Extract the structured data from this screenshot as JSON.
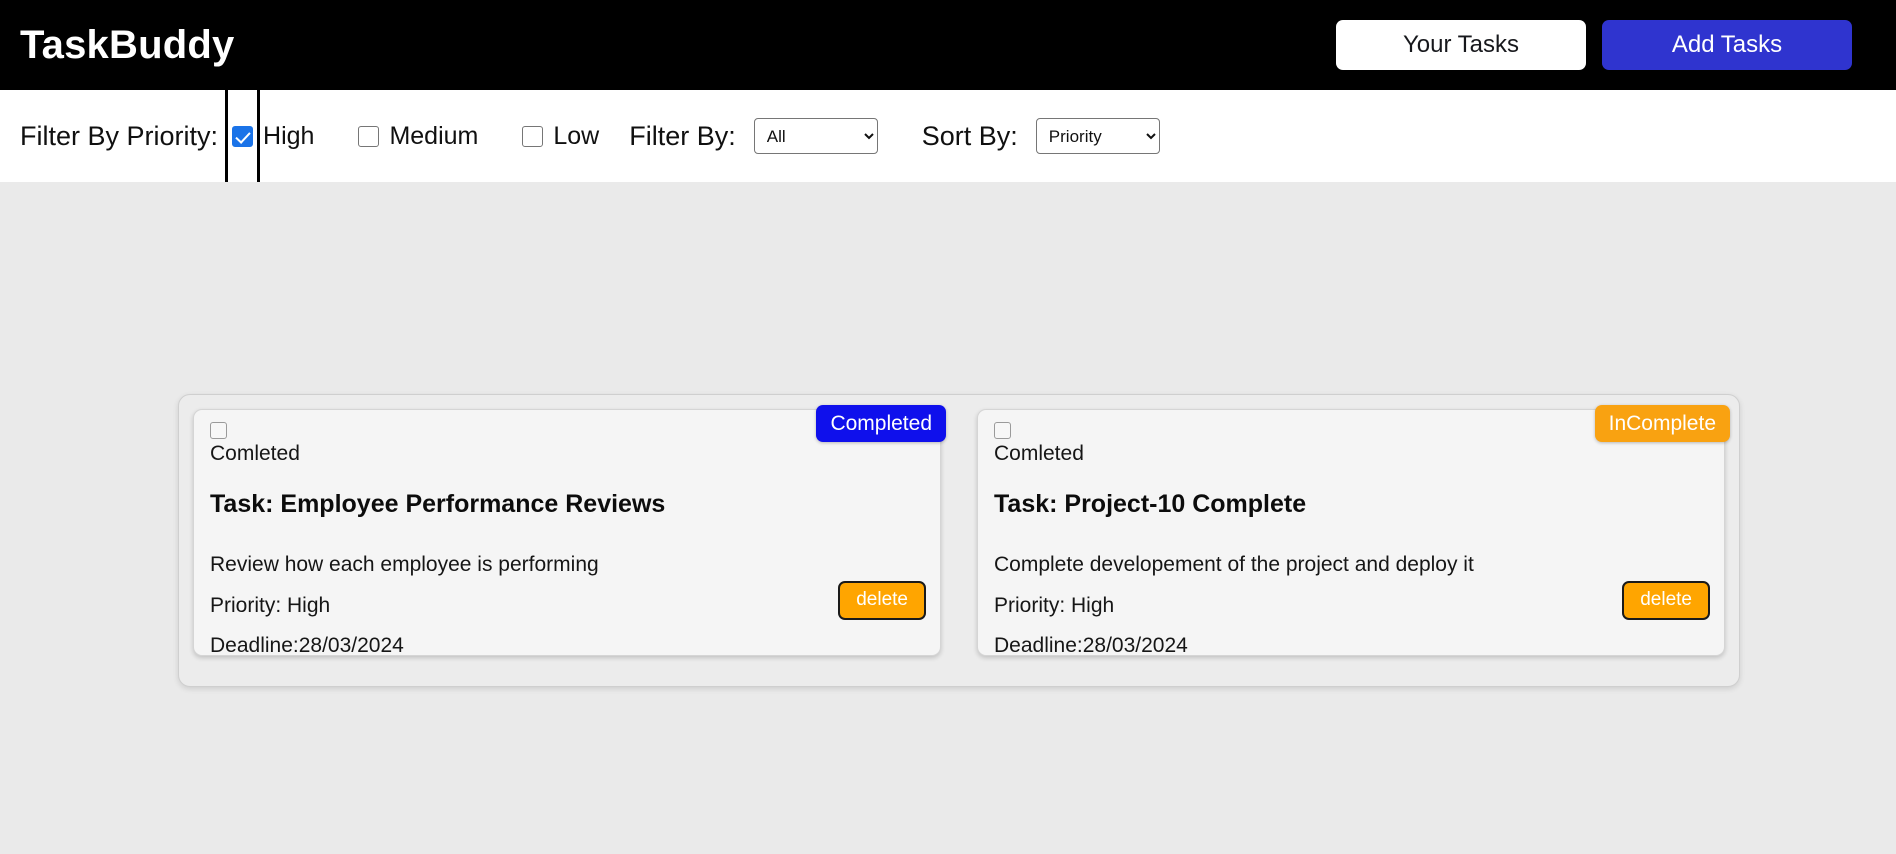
{
  "header": {
    "brand": "TaskBuddy",
    "your_tasks_label": "Your Tasks",
    "add_tasks_label": "Add Tasks",
    "bg_color": "#000000",
    "primary_color": "#2f34cf"
  },
  "filters": {
    "priority_label": "Filter By Priority:",
    "priority_options": [
      {
        "label": "High",
        "checked": true
      },
      {
        "label": "Medium",
        "checked": false
      },
      {
        "label": "Low",
        "checked": false
      }
    ],
    "filter_by_label": "Filter By:",
    "filter_by_value": "All",
    "sort_by_label": "Sort By:",
    "sort_by_value": "Priority"
  },
  "tasks": [
    {
      "checkbox_label": "Comleted",
      "title": "Task: Employee Performance Reviews",
      "description": "Review how each employee is performing",
      "priority": "Priority: High",
      "deadline": "Deadline:28/03/2024",
      "status": "Completed",
      "status_color": "#0f10ec",
      "delete_label": "delete"
    },
    {
      "checkbox_label": "Comleted",
      "title": "Task: Project-10 Complete",
      "description": "Complete developement of the project and deploy it",
      "priority": "Priority: High",
      "deadline": "Deadline:28/03/2024",
      "status": "InComplete",
      "status_color": "#f9a211",
      "delete_label": "delete"
    }
  ],
  "colors": {
    "page_background": "#eaeaea",
    "filterbar_background": "#ffffff",
    "panel_background": "#ececec",
    "card_background": "#f5f5f5",
    "delete_button": "#ffa500"
  }
}
